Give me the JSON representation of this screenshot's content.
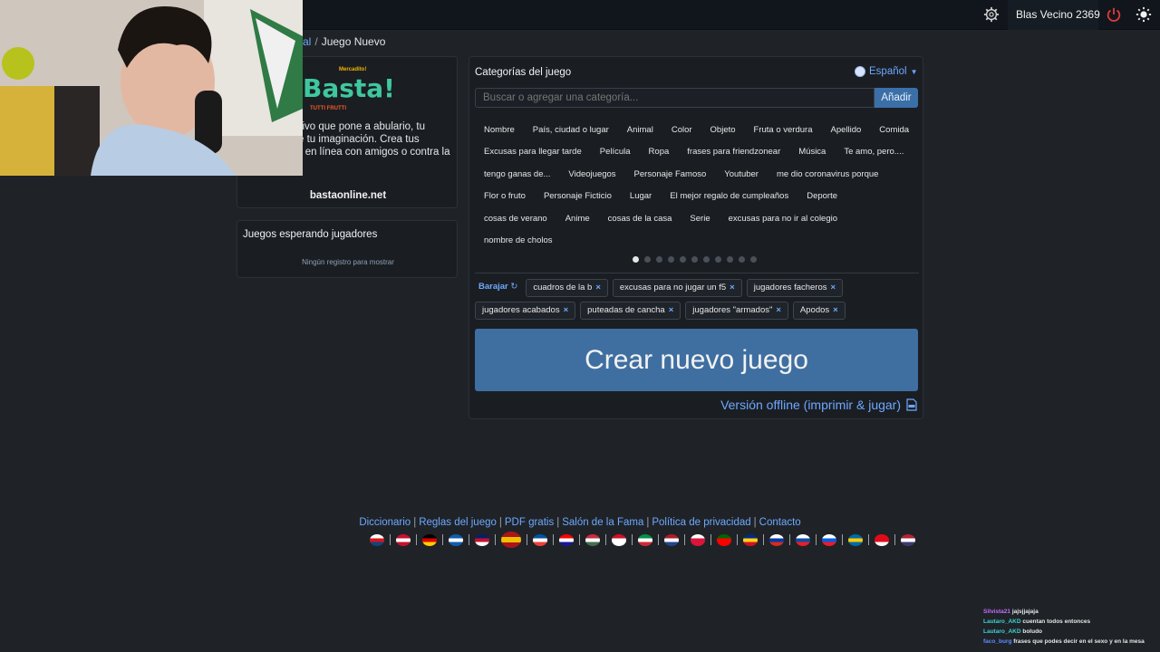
{
  "topbar": {
    "username": "Blas Vecino 2369",
    "icons": [
      "gear-icon",
      "power-icon",
      "sun-icon"
    ]
  },
  "breadcrumb": {
    "link": "al",
    "current": "Juego Nuevo"
  },
  "intro": {
    "logo_small": "Mercadito!",
    "logo_big": "Basta!",
    "logo_sub": "TUTTI FRUTTI",
    "description": "alabras creativo que pone a abulario, tu capacidad de tu imaginación. Crea tus propias uega en línea con amigos o contra la IA.",
    "site": "bastaonline.net"
  },
  "waiting": {
    "title": "Juegos esperando jugadores",
    "empty": "Ningún registro para mostrar"
  },
  "categories": {
    "title": "Categorías del juego",
    "language": "Español",
    "search_placeholder": "Buscar o agregar una categoría...",
    "add_label": "Añadir",
    "rows": [
      [
        "Nombre",
        "País, ciudad o lugar",
        "Animal",
        "Color",
        "Objeto",
        "Fruta o verdura",
        "Apellido",
        "Comida"
      ],
      [
        "Excusas para llegar tarde",
        "Película",
        "Ropa",
        "frases para friendzonear",
        "Música",
        "Te amo, pero...."
      ],
      [
        "tengo ganas de...",
        "Videojuegos",
        "Personaje Famoso",
        "Youtuber",
        "me dio coronavirus porque"
      ],
      [
        "Flor o fruto",
        "Personaje Ficticio",
        "Lugar",
        "El mejor regalo de cumpleaños",
        "Deporte"
      ],
      [
        "cosas de verano",
        "Anime",
        "cosas de la casa",
        "Serie",
        "excusas para no ir al colegio"
      ],
      [
        "nombre de cholos"
      ]
    ],
    "page_count": 11,
    "active_page": 1
  },
  "selected": {
    "shuffle_label": "Barajar",
    "row1": [
      "cuadros de la b",
      "excusas para no jugar un f5",
      "jugadores facheros"
    ],
    "row2": [
      "jugadores acabados",
      "puteadas de cancha",
      "jugadores \"armados\"",
      "Apodos"
    ]
  },
  "actions": {
    "create": "Crear nuevo juego",
    "offline": "Versión offline (imprimir & jugar)"
  },
  "footer": {
    "links": [
      "Diccionario",
      "Reglas del juego",
      "PDF gratis",
      "Salón de la Fama",
      "Política de privacidad",
      "Contacto"
    ],
    "flags": [
      "czech",
      "denmark",
      "germany",
      "greece",
      "uk",
      "spain",
      "france",
      "croatia",
      "hungary",
      "indonesia",
      "italy",
      "netherlands",
      "poland",
      "portugal",
      "romania",
      "russia",
      "slovakia",
      "slovenia",
      "sweden",
      "turkey",
      "usa"
    ],
    "active_flag": "spain"
  },
  "chat": [
    {
      "user": "Silvista21",
      "msg": "jajsjjajaja"
    },
    {
      "user": "Lautaro_AKD",
      "msg": "cuentan todos entonces"
    },
    {
      "user": "Lautaro_AKD",
      "msg": "boludo"
    },
    {
      "user": "faco_burg",
      "msg": "frases que podes decir en el sexo y en la mesa"
    }
  ],
  "colors": {
    "accent": "#6ea8fe",
    "create_button": "#3f6fa1",
    "background": "#1f2328"
  }
}
